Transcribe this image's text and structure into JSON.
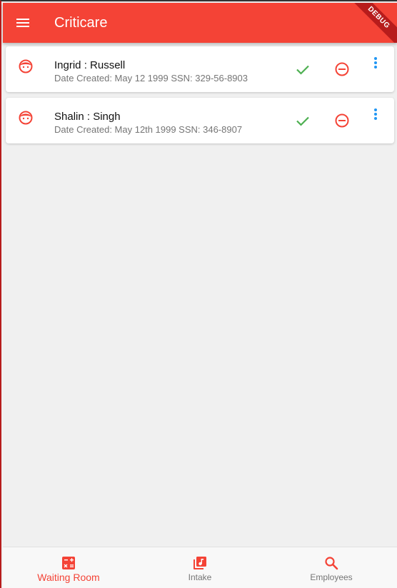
{
  "appbar": {
    "title": "Criticare",
    "menu_icon": "menu-icon",
    "debug_label": "DEBUG"
  },
  "patients": [
    {
      "name": "Ingrid : Russell",
      "subtitle": "Date Created: May 12 1999 SSN: 329-56-8903",
      "avatar_icon": "face-icon"
    },
    {
      "name": "Shalin : Singh",
      "subtitle": "Date Created: May 12th 1999 SSN: 346-8907",
      "avatar_icon": "face-icon"
    }
  ],
  "actions": {
    "approve_icon": "check-icon",
    "remove_icon": "remove-circle-icon",
    "more_icon": "more-vert-icon"
  },
  "bottom_nav": {
    "items": [
      {
        "label": "Waiting Room",
        "icon": "calculator-icon",
        "active": true
      },
      {
        "label": "Intake",
        "icon": "library-music-icon",
        "active": false
      },
      {
        "label": "Employees",
        "icon": "search-icon",
        "active": false
      }
    ]
  },
  "colors": {
    "primary": "#f44336",
    "approve": "#4caf50",
    "more": "#2196f3",
    "inactive": "#757575"
  }
}
